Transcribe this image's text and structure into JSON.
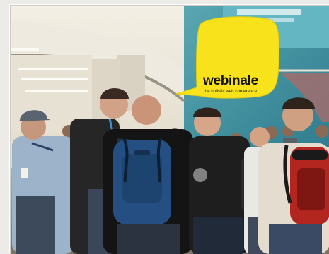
{
  "photo": {
    "scene": "conference-hallway-crowd",
    "icons": [
      "backpack-icon",
      "cap-icon"
    ]
  },
  "badge": {
    "brand": "webinale",
    "tagline": "the holistic web conference",
    "color": "#f7e21b"
  }
}
